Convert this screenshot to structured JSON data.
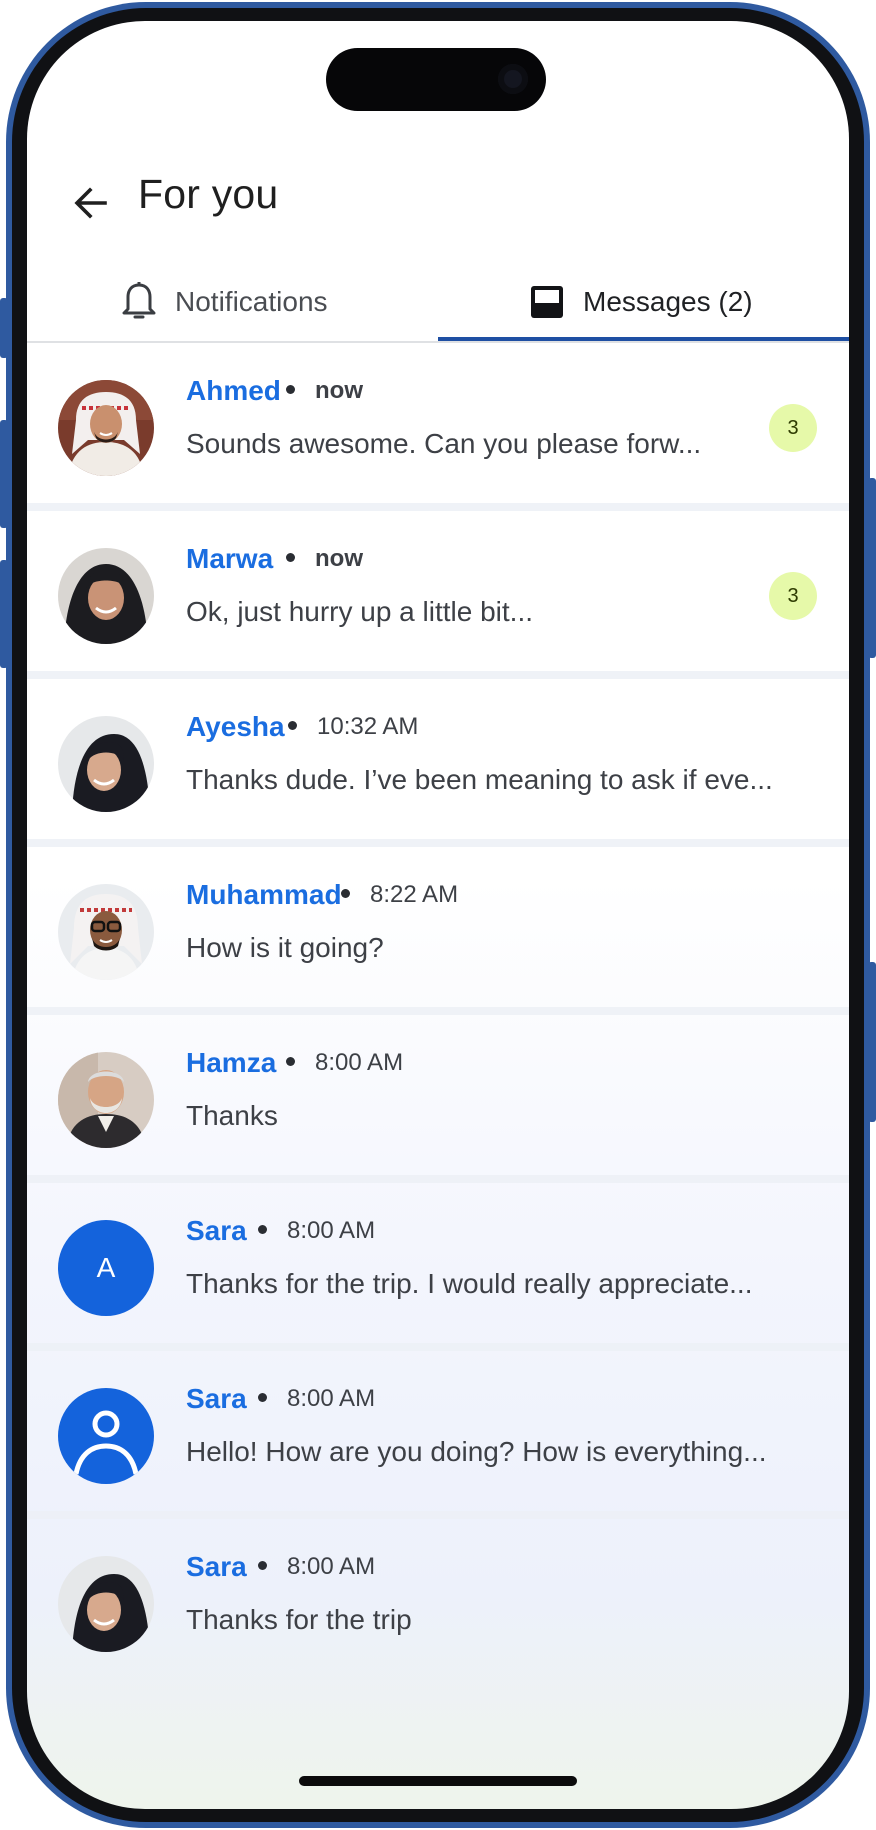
{
  "header": {
    "title": "For you"
  },
  "tabs": [
    {
      "label": "Notifications",
      "icon": "bell-icon",
      "active": false
    },
    {
      "label": "Messages (2)",
      "icon": "inbox-icon",
      "active": true
    }
  ],
  "messages": [
    {
      "name": "Ahmed",
      "time": "now",
      "preview": "Sounds awesome. Can you please forw...",
      "badge": "3",
      "avatar": "photo-man-shemagh"
    },
    {
      "name": "Marwa",
      "time": "now",
      "preview": "Ok, just hurry up a little bit...",
      "badge": "3",
      "avatar": "photo-woman-hijab"
    },
    {
      "name": "Ayesha",
      "time": "10:32 AM",
      "preview": "Thanks dude. I’ve been meaning to ask if eve...",
      "avatar": "photo-woman-hijab"
    },
    {
      "name": "Muhammad",
      "time": "8:22 AM",
      "preview": "How is it going?",
      "avatar": "photo-man-glasses"
    },
    {
      "name": "Hamza",
      "time": "8:00 AM",
      "preview": "Thanks",
      "avatar": "photo-older-man"
    },
    {
      "name": "Sara",
      "time": "8:00 AM",
      "preview": "Thanks for the trip. I would really appreciate...",
      "avatar": "initial",
      "initial": "A"
    },
    {
      "name": "Sara",
      "time": "8:00 AM",
      "preview": "Hello! How are you doing? How is everything...",
      "avatar": "person-icon"
    },
    {
      "name": "Sara",
      "time": "8:00 AM",
      "preview": "Thanks for the trip",
      "avatar": "photo-woman-hijab"
    }
  ],
  "colors": {
    "accent": "#1a6de0",
    "tab_underline": "#1e4fa3",
    "badge_bg": "#e6f9a9",
    "frame": "#2f5aa0"
  }
}
